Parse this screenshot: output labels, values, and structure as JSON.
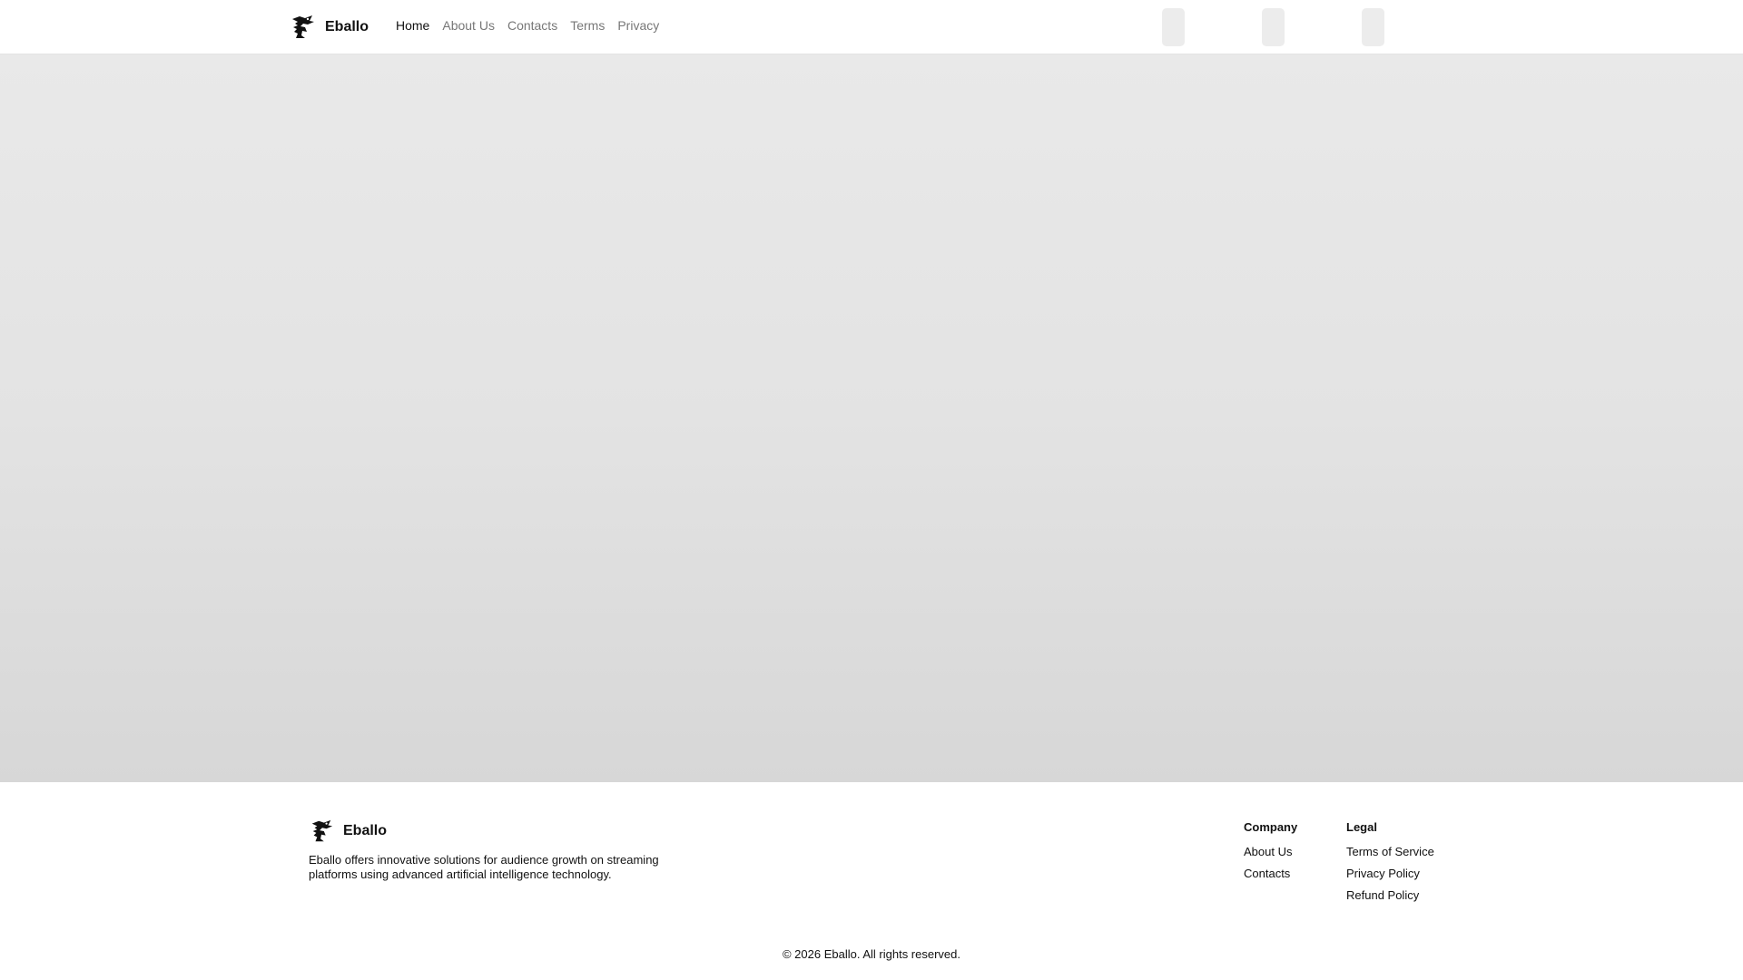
{
  "header": {
    "brand": "Eballo",
    "nav": [
      {
        "label": "Home",
        "active": true
      },
      {
        "label": "About Us",
        "active": false
      },
      {
        "label": "Contacts",
        "active": false
      },
      {
        "label": "Terms",
        "active": false
      },
      {
        "label": "Privacy",
        "active": false
      }
    ]
  },
  "footer": {
    "brand": "Eballo",
    "description": "Eballo offers innovative solutions for audience growth on streaming platforms using advanced artificial intelligence technology.",
    "company": {
      "heading": "Company",
      "links": [
        "About Us",
        "Contacts"
      ]
    },
    "legal": {
      "heading": "Legal",
      "links": [
        "Terms of Service",
        "Privacy Policy",
        "Refund Policy"
      ]
    },
    "copyright": "© 2026 Eballo. All rights reserved."
  },
  "icons": {
    "logo": "dragon-logo-icon"
  },
  "colors": {
    "nav_active": "#111111",
    "nav_inactive": "#777777",
    "skeleton": "#ececec",
    "hero_top": "#e9e9e9",
    "hero_bottom": "#d7d7d7"
  }
}
